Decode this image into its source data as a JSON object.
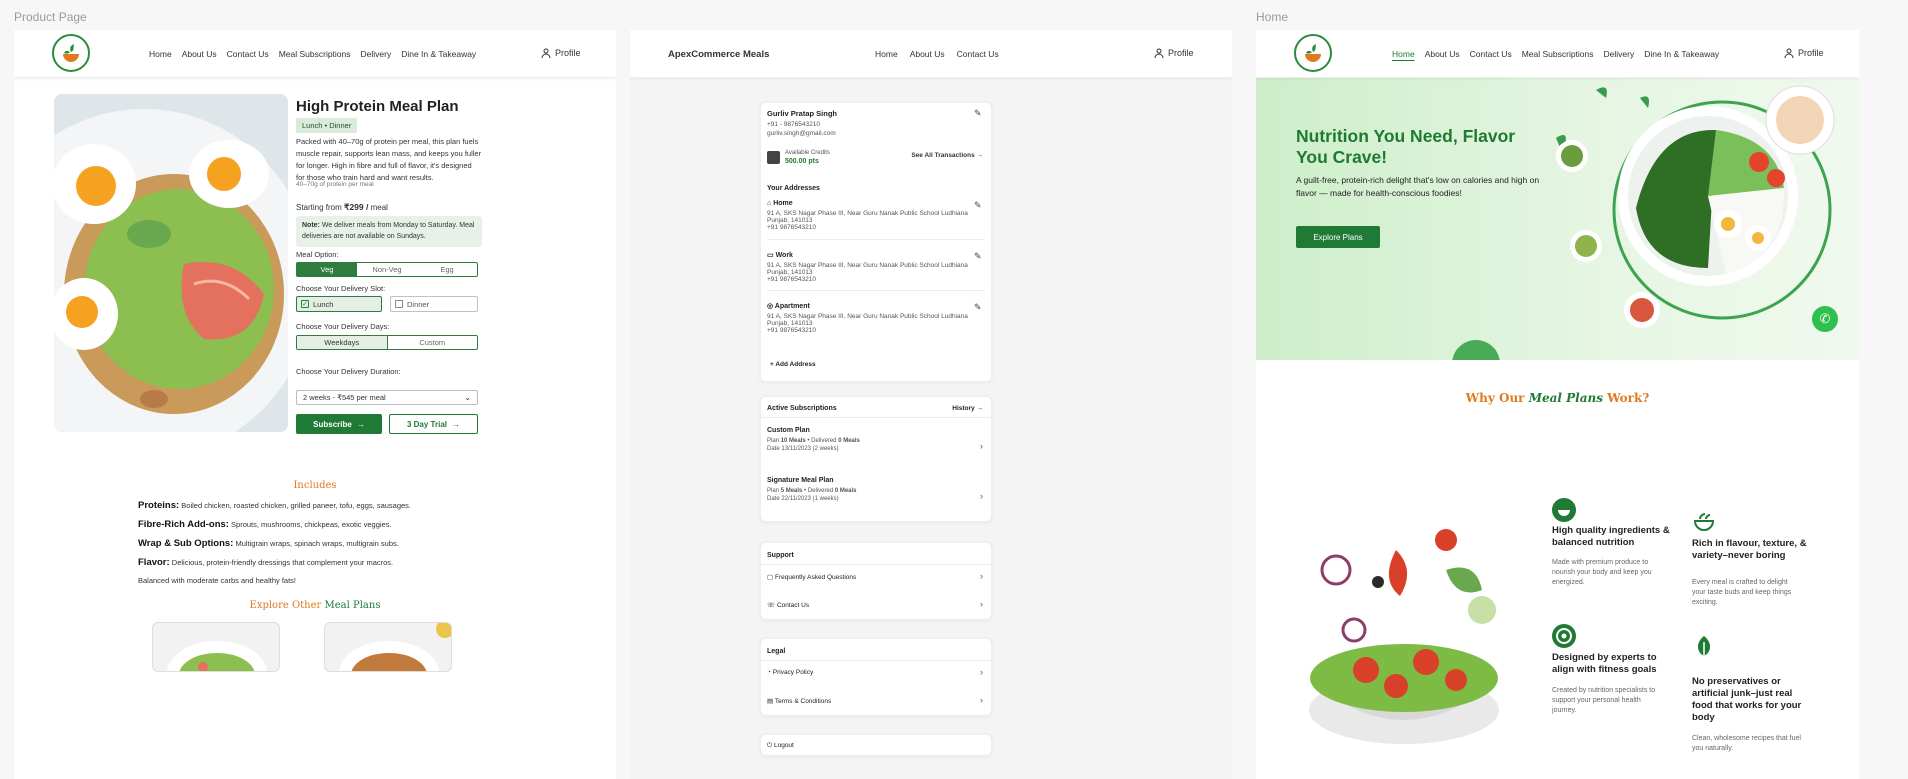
{
  "frames": {
    "product_label": "Product Page",
    "home_label": "Home"
  },
  "nav": {
    "items": [
      "Home",
      "About Us",
      "Contact Us",
      "Meal Subscriptions",
      "Delivery",
      "Dine In & Takeaway"
    ],
    "profile": "Profile",
    "brand": "ApexCommerce Meals",
    "short_items": [
      "Home",
      "About Us",
      "Contact Us"
    ]
  },
  "product": {
    "title": "High Protein Meal Plan",
    "tag": "Lunch • Dinner",
    "description": "Packed with 40–70g of protein per meal, this plan fuels muscle repair, supports lean mass, and keeps you fuller for longer. High in fibre and full of flavor, it's designed for those who train hard and want results.",
    "protein_note": "40–70g of protein per meal",
    "price_prefix": "Starting from",
    "price": "₹299 /",
    "price_suffix": "meal",
    "note_bold": "Note:",
    "note_text": "We deliver meals from Monday to Saturday. Meal deliveries are not available on Sundays.",
    "meal_option_label": "Meal Option:",
    "meal_options": [
      "Veg",
      "Non-Veg",
      "Egg"
    ],
    "slot_label": "Choose Your Delivery Slot:",
    "slots": [
      "Lunch",
      "Dinner"
    ],
    "days_label": "Choose Your Delivery Days:",
    "days": [
      "Weekdays",
      "Custom"
    ],
    "duration_label": "Choose Your Delivery Duration:",
    "duration_value": "2 weeks - ₹545 per meal",
    "subscribe": "Subscribe",
    "trial": "3 Day Trial",
    "includes_title": "Includes",
    "includes": [
      {
        "k": "Proteins:",
        "v": "Boiled chicken, roasted chicken, grilled paneer, tofu, eggs, sausages."
      },
      {
        "k": "Fibre-Rich Add-ons:",
        "v": "Sprouts, mushrooms, chickpeas, exotic veggies."
      },
      {
        "k": "Wrap & Sub Options:",
        "v": "Multigrain wraps, spinach wraps, multigrain subs."
      },
      {
        "k": "Flavor:",
        "v": "Delicious, protein-friendly dressings that complement your macros."
      }
    ],
    "includes_footer": "Balanced with moderate carbs and healthy fats!",
    "explore_a": "Explore Other",
    "explore_b": "Meal Plans"
  },
  "profile": {
    "name": "Gurliv Pratap Singh",
    "phone": "+91 - 9876543210",
    "email": "gurliv.singh@gmail.com",
    "credits_label": "Available Credits",
    "credits_value": "500.00 pts",
    "transactions": "See All Transactions",
    "addresses_title": "Your Addresses",
    "addresses": [
      {
        "label": "Home",
        "line": "91 A, SKS Nagar Phase III, Near Guru Nanak Public School Ludhiana Punjab, 141013",
        "phone": "+91 9876543210"
      },
      {
        "label": "Work",
        "line": "91 A, SKS Nagar Phase III, Near Guru Nanak Public School Ludhiana Punjab, 141013",
        "phone": "+91 9876543210"
      },
      {
        "label": "Apartment",
        "line": "91 A, SKS Nagar Phase III, Near Guru Nanak Public School Ludhiana Punjab, 141013",
        "phone": "+91 9876543210"
      }
    ],
    "add_address": "+ Add Address",
    "subs_title": "Active Subscriptions",
    "history": "History",
    "subs": [
      {
        "name": "Custom Plan",
        "plan": "10 Meals",
        "delivered": "0 Meals",
        "date": "13/11/2023",
        "weeks": "(2 weeks)"
      },
      {
        "name": "Signature Meal Plan",
        "plan": "5 Meals",
        "delivered": "0 Meals",
        "date": "22/11/2023",
        "weeks": "(1 weeks)"
      }
    ],
    "plan_label": "Plan",
    "delivered_label": "• Delivered",
    "date_label": "Date",
    "support_title": "Support",
    "support": [
      "Frequently Asked Questions",
      "Contact Us"
    ],
    "legal_title": "Legal",
    "legal": [
      "Privacy Policy",
      "Terms & Conditions"
    ],
    "logout": "Logout"
  },
  "home": {
    "hero_title": "Nutrition You Need, Flavor You Crave!",
    "hero_text": "A guilt-free, protein-rich delight that's low on calories and high on flavor — made for health-conscious foodies!",
    "cta": "Explore Plans",
    "why_a": "Why Our",
    "why_b": "Meal Plans",
    "why_c": "Work?",
    "features": [
      {
        "title": "High quality ingredients & balanced nutrition",
        "text": "Made with premium produce to nourish your body and keep you energized."
      },
      {
        "title": "Rich in flavour, texture, & variety–never boring",
        "text": "Every meal is crafted to delight your taste buds and keep things exciting."
      },
      {
        "title": "Designed by experts to align with fitness goals",
        "text": "Created by nutrition specialists to support your personal health journey."
      },
      {
        "title": "No preservatives or artificial junk–just real food that works for your body",
        "text": "Clean, wholesome recipes that fuel you naturally."
      }
    ]
  },
  "colors": {
    "brand_green": "#1f7a35",
    "accent_orange": "#e07a1f",
    "hero_bg": "#d6f0d2"
  }
}
